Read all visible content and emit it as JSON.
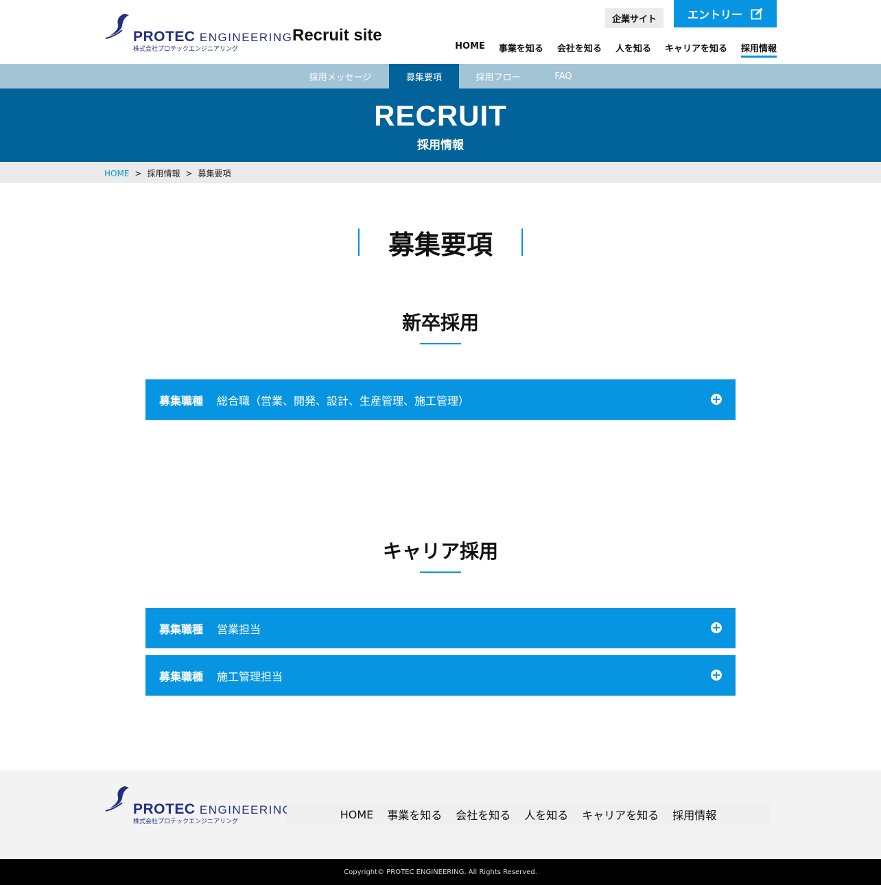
{
  "header": {
    "logo_brand": "PROTEC",
    "logo_brand2": "ENGINEERING",
    "logo_sub": "株式会社プロテックエンジニアリング",
    "site_label": "Recruit site",
    "corp_site_label": "企業サイト",
    "entry_label": "エントリー",
    "entry_icon": "edit-icon",
    "nav": [
      "HOME",
      "事業を知る",
      "会社を知る",
      "人を知る",
      "キャリアを知る",
      "採用情報"
    ],
    "active_nav": "採用情報"
  },
  "subnav": {
    "items": [
      "採用メッセージ",
      "募集要項",
      "採用フロー",
      "FAQ"
    ],
    "active": "募集要項"
  },
  "banner": {
    "title_en": "RECRUIT",
    "title_jp": "採用情報"
  },
  "breadcrumb": {
    "home": "HOME",
    "sep": ">",
    "level2": "採用情報",
    "current": "募集要項"
  },
  "page_title": "募集要項",
  "sections": [
    {
      "title": "新卒採用",
      "items": [
        {
          "label": "募集職種",
          "value": "総合職（営業、開発、設計、生産管理、施工管理）"
        }
      ]
    },
    {
      "title": "キャリア採用",
      "items": [
        {
          "label": "募集職種",
          "value": "営業担当"
        },
        {
          "label": "募集職種",
          "value": "施工管理担当"
        }
      ]
    }
  ],
  "accordion_icon": "plus-circle-icon",
  "footer": {
    "nav": [
      "HOME",
      "事業を知る",
      "会社を知る",
      "人を知る",
      "キャリアを知る",
      "採用情報"
    ],
    "copyright": "Copyright© PROTEC ENGINEERING. All Rights Reserved."
  },
  "colors": {
    "accent": "#0795e2",
    "banner": "#02629a",
    "subnav": "#a3c4d6",
    "logo": "#23317d"
  }
}
